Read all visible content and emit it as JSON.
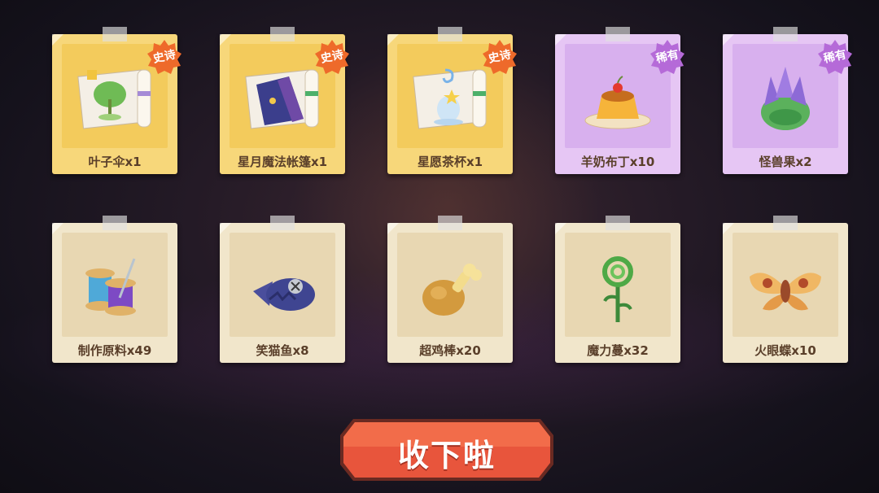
{
  "rewards": [
    {
      "name": "叶子伞x1",
      "rarity": "epic",
      "badge": "史诗",
      "icon": "leaf-umbrella-scroll-icon"
    },
    {
      "name": "星月魔法帐篷x1",
      "rarity": "epic",
      "badge": "史诗",
      "icon": "starmoon-tent-scroll-icon"
    },
    {
      "name": "星愿茶杯x1",
      "rarity": "epic",
      "badge": "史诗",
      "icon": "wish-teacup-scroll-icon"
    },
    {
      "name": "羊奶布丁x10",
      "rarity": "rare",
      "badge": "稀有",
      "icon": "pudding-icon"
    },
    {
      "name": "怪兽果x2",
      "rarity": "rare",
      "badge": "稀有",
      "icon": "monster-fruit-icon"
    },
    {
      "name": "制作原料x49",
      "rarity": "common",
      "badge": "",
      "icon": "thread-spool-icon"
    },
    {
      "name": "笑猫鱼x8",
      "rarity": "common",
      "badge": "",
      "icon": "fish-icon"
    },
    {
      "name": "超鸡棒x20",
      "rarity": "common",
      "badge": "",
      "icon": "drumstick-icon"
    },
    {
      "name": "魔力蔓x32",
      "rarity": "common",
      "badge": "",
      "icon": "fern-sprout-icon"
    },
    {
      "name": "火眼蝶x10",
      "rarity": "common",
      "badge": "",
      "icon": "moth-icon"
    }
  ],
  "collect_button": {
    "label": "收下啦"
  },
  "colors": {
    "epic_badge": "#ee6a2a",
    "rare_badge": "#b56ad8",
    "button": "#e8553c"
  }
}
